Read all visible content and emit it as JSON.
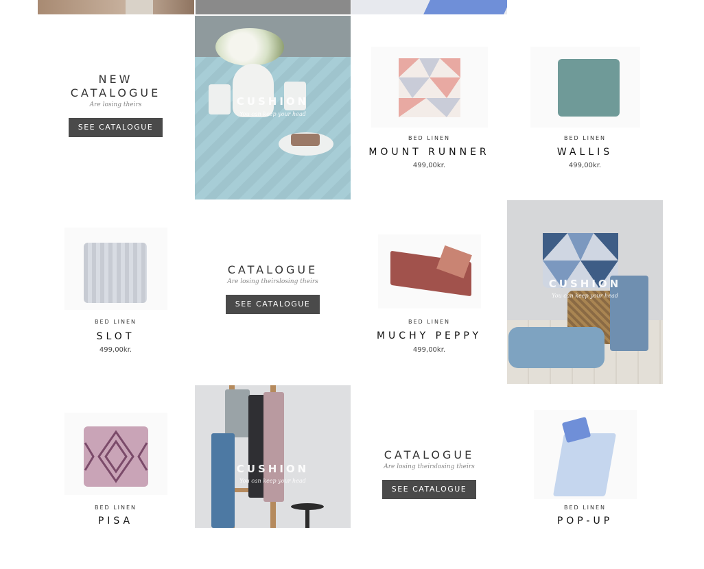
{
  "top_strip": {},
  "promos": [
    {
      "title_line1": "NEW",
      "title_line2": "CATALOGUE",
      "subtitle": "Are losing theirs",
      "button": "SEE CATALOGUE"
    },
    {
      "title_line1": "",
      "title_line2": "CATALOGUE",
      "subtitle": "Are losing theirslosing theirs",
      "button": "SEE CATALOGUE"
    },
    {
      "title_line1": "",
      "title_line2": "CATALOGUE",
      "subtitle": "Are losing theirslosing theirs",
      "button": "SEE CATALOGUE"
    }
  ],
  "photos": [
    {
      "title": "CUSHION",
      "subtitle": "You can keep your head"
    },
    {
      "title": "CUSHION",
      "subtitle": "You can keep your head"
    },
    {
      "title": "CUSHION",
      "subtitle": "You can keep your head"
    }
  ],
  "products": [
    {
      "category": "BED LINEN",
      "name": "MOUNT RUNNER",
      "price": "499,00kr."
    },
    {
      "category": "BED LINEN",
      "name": "WALLIS",
      "price": "499,00kr."
    },
    {
      "category": "BED LINEN",
      "name": "SLOT",
      "price": "499,00kr."
    },
    {
      "category": "BED LINEN",
      "name": "MUCHY PEPPY",
      "price": "499,00kr."
    },
    {
      "category": "BED LINEN",
      "name": "PISA",
      "price": ""
    },
    {
      "category": "BED LINEN",
      "name": "POP-UP",
      "price": ""
    }
  ],
  "colors": {
    "button": "#4a4a4a",
    "accent_blue": "#6f8fd8"
  }
}
